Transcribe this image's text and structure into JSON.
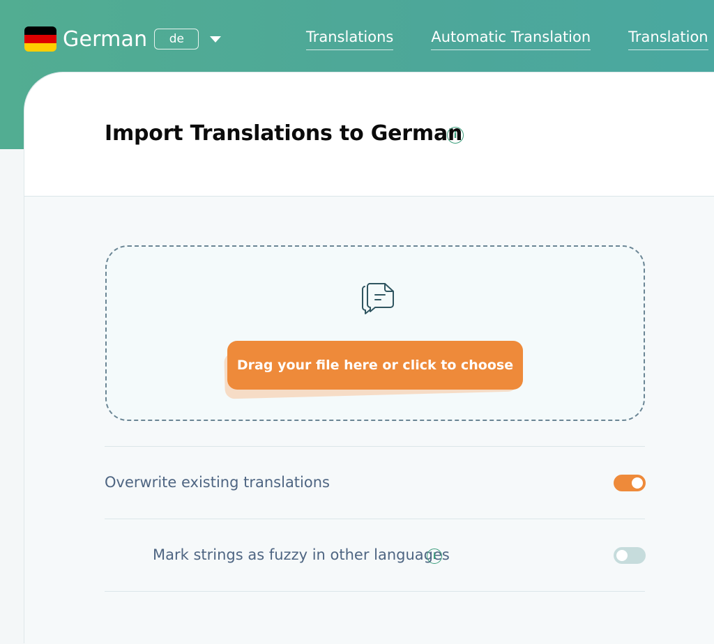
{
  "header": {
    "language": {
      "name": "German",
      "code": "de",
      "flag_colors": [
        "#000000",
        "#dd0000",
        "#ffce00"
      ]
    },
    "nav": [
      {
        "label": "Translations"
      },
      {
        "label": "Automatic Translation"
      },
      {
        "label": "Translation"
      }
    ]
  },
  "main": {
    "title": "Import Translations to German",
    "title_info_icon": "i",
    "dropzone": {
      "icon": "document-chat-icon",
      "button_label": "Drag your file here or click to choose"
    },
    "options": [
      {
        "label": "Overwrite existing translations",
        "enabled": true
      },
      {
        "label": "Mark strings as fuzzy in other languages",
        "info_icon": "i",
        "enabled": false
      }
    ]
  },
  "colors": {
    "accent_green": "#4da799",
    "accent_orange": "#ee8a3a",
    "text_muted": "#4e6582"
  }
}
